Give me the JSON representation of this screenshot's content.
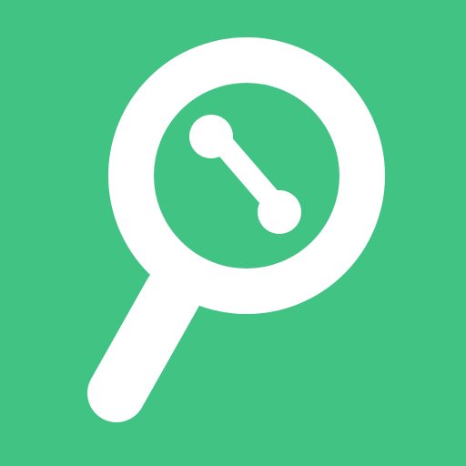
{
  "icon": {
    "name": "phone-lookup-magnifier-icon",
    "colors": {
      "background": "#41C483",
      "glyph": "#FFFFFF"
    }
  }
}
